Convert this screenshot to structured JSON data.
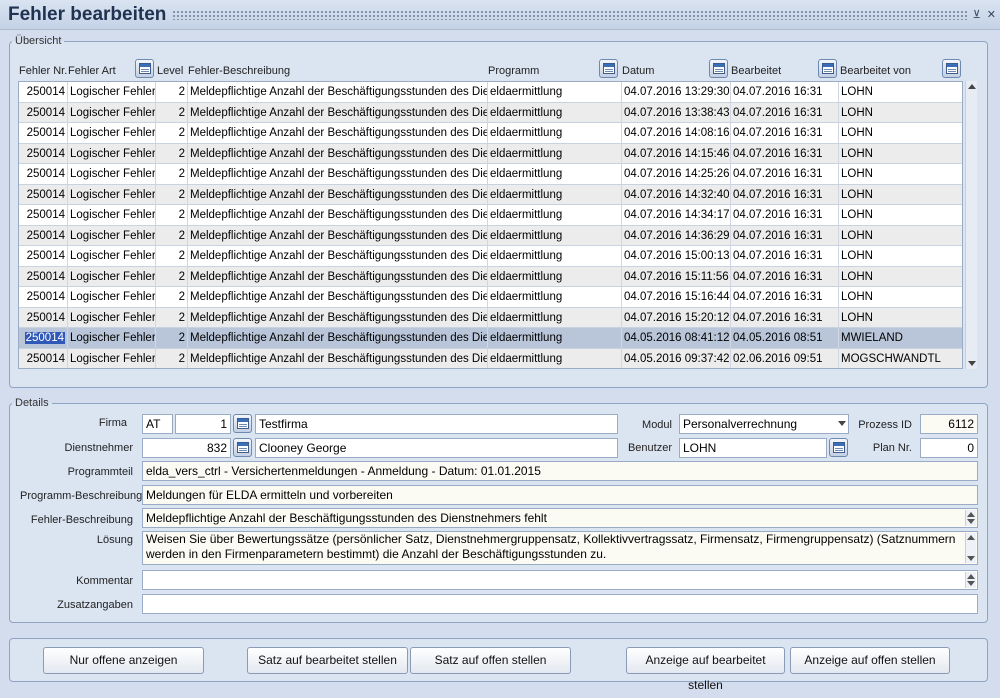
{
  "window": {
    "title": "Fehler bearbeiten",
    "controls": [
      "⊻",
      "✕"
    ]
  },
  "overview": {
    "legend": "Übersicht",
    "columns": {
      "nr": "Fehler Nr.",
      "art": "Fehler Art",
      "level": "Level",
      "desc": "Fehler-Beschreibung",
      "prog": "Programm",
      "datum": "Datum",
      "bearbeitet": "Bearbeitet",
      "von": "Bearbeitet von"
    },
    "rows": [
      {
        "nr": "250014",
        "art": "Logischer Fehler",
        "level": "2",
        "desc": "Meldepflichtige Anzahl der Beschäftigungsstunden des Dien",
        "prog": "eldaermittlung",
        "datum": "04.07.2016 13:29:30",
        "bearbeitet": "04.07.2016 16:31",
        "von": "LOHN"
      },
      {
        "nr": "250014",
        "art": "Logischer Fehler",
        "level": "2",
        "desc": "Meldepflichtige Anzahl der Beschäftigungsstunden des Dien",
        "prog": "eldaermittlung",
        "datum": "04.07.2016 13:38:43",
        "bearbeitet": "04.07.2016 16:31",
        "von": "LOHN"
      },
      {
        "nr": "250014",
        "art": "Logischer Fehler",
        "level": "2",
        "desc": "Meldepflichtige Anzahl der Beschäftigungsstunden des Dien",
        "prog": "eldaermittlung",
        "datum": "04.07.2016 14:08:16",
        "bearbeitet": "04.07.2016 16:31",
        "von": "LOHN"
      },
      {
        "nr": "250014",
        "art": "Logischer Fehler",
        "level": "2",
        "desc": "Meldepflichtige Anzahl der Beschäftigungsstunden des Dien",
        "prog": "eldaermittlung",
        "datum": "04.07.2016 14:15:46",
        "bearbeitet": "04.07.2016 16:31",
        "von": "LOHN"
      },
      {
        "nr": "250014",
        "art": "Logischer Fehler",
        "level": "2",
        "desc": "Meldepflichtige Anzahl der Beschäftigungsstunden des Dien",
        "prog": "eldaermittlung",
        "datum": "04.07.2016 14:25:26",
        "bearbeitet": "04.07.2016 16:31",
        "von": "LOHN"
      },
      {
        "nr": "250014",
        "art": "Logischer Fehler",
        "level": "2",
        "desc": "Meldepflichtige Anzahl der Beschäftigungsstunden des Dien",
        "prog": "eldaermittlung",
        "datum": "04.07.2016 14:32:40",
        "bearbeitet": "04.07.2016 16:31",
        "von": "LOHN"
      },
      {
        "nr": "250014",
        "art": "Logischer Fehler",
        "level": "2",
        "desc": "Meldepflichtige Anzahl der Beschäftigungsstunden des Dien",
        "prog": "eldaermittlung",
        "datum": "04.07.2016 14:34:17",
        "bearbeitet": "04.07.2016 16:31",
        "von": "LOHN"
      },
      {
        "nr": "250014",
        "art": "Logischer Fehler",
        "level": "2",
        "desc": "Meldepflichtige Anzahl der Beschäftigungsstunden des Dien",
        "prog": "eldaermittlung",
        "datum": "04.07.2016 14:36:29",
        "bearbeitet": "04.07.2016 16:31",
        "von": "LOHN"
      },
      {
        "nr": "250014",
        "art": "Logischer Fehler",
        "level": "2",
        "desc": "Meldepflichtige Anzahl der Beschäftigungsstunden des Dien",
        "prog": "eldaermittlung",
        "datum": "04.07.2016 15:00:13",
        "bearbeitet": "04.07.2016 16:31",
        "von": "LOHN"
      },
      {
        "nr": "250014",
        "art": "Logischer Fehler",
        "level": "2",
        "desc": "Meldepflichtige Anzahl der Beschäftigungsstunden des Dien",
        "prog": "eldaermittlung",
        "datum": "04.07.2016 15:11:56",
        "bearbeitet": "04.07.2016 16:31",
        "von": "LOHN"
      },
      {
        "nr": "250014",
        "art": "Logischer Fehler",
        "level": "2",
        "desc": "Meldepflichtige Anzahl der Beschäftigungsstunden des Dien",
        "prog": "eldaermittlung",
        "datum": "04.07.2016 15:16:44",
        "bearbeitet": "04.07.2016 16:31",
        "von": "LOHN"
      },
      {
        "nr": "250014",
        "art": "Logischer Fehler",
        "level": "2",
        "desc": "Meldepflichtige Anzahl der Beschäftigungsstunden des Dien",
        "prog": "eldaermittlung",
        "datum": "04.07.2016 15:20:12",
        "bearbeitet": "04.07.2016 16:31",
        "von": "LOHN"
      },
      {
        "nr": "250014",
        "art": "Logischer Fehler",
        "level": "2",
        "desc": "Meldepflichtige Anzahl der Beschäftigungsstunden des Dien",
        "prog": "eldaermittlung",
        "datum": "04.05.2016 08:41:12",
        "bearbeitet": "04.05.2016 08:51",
        "von": "MWIELAND",
        "selected": true
      },
      {
        "nr": "250014",
        "art": "Logischer Fehler",
        "level": "2",
        "desc": "Meldepflichtige Anzahl der Beschäftigungsstunden des Dien",
        "prog": "eldaermittlung",
        "datum": "04.05.2016 09:37:42",
        "bearbeitet": "02.06.2016 09:51",
        "von": "MOGSCHWANDTL"
      }
    ]
  },
  "details": {
    "legend": "Details",
    "firma_label": "Firma",
    "firma_country": "AT",
    "firma_nr": "1",
    "firma_name": "Testfirma",
    "modul_label": "Modul",
    "modul_value": "Personalverrechnung",
    "prozess_label": "Prozess ID",
    "prozess_value": "6112",
    "dn_label": "Dienstnehmer",
    "dn_nr": "832",
    "dn_name": "Clooney George",
    "benutzer_label": "Benutzer",
    "benutzer_value": "LOHN",
    "plan_label": "Plan Nr.",
    "plan_value": "0",
    "programmteil_label": "Programmteil",
    "programmteil_value": "elda_vers_ctrl - Versichertenmeldungen - Anmeldung - Datum: 01.01.2015",
    "progdesc_label": "Programm-Beschreibung",
    "progdesc_value": "Meldungen für ELDA ermitteln und vorbereiten",
    "fehlerdesc_label": "Fehler-Beschreibung",
    "fehlerdesc_value": "Meldepflichtige Anzahl der Beschäftigungsstunden des Dienstnehmers fehlt",
    "loesung_label": "Lösung",
    "loesung_value": "Weisen Sie über Bewertungssätze (persönlicher Satz, Dienstnehmergruppensatz, Kollektivvertragssatz, Firmensatz, Firmengruppensatz) (Satznummern werden in den Firmenparametern bestimmt) die Anzahl der Beschäftigungsstunden zu.",
    "kommentar_label": "Kommentar",
    "kommentar_value": "",
    "zusatz_label": "Zusatzangaben",
    "zusatz_value": ""
  },
  "buttons": {
    "nur_offene": "Nur offene anzeigen",
    "satz_bearbeitet": "Satz auf bearbeitet stellen",
    "satz_offen": "Satz auf offen stellen",
    "anzeige_bearbeitet": "Anzeige auf bearbeitet stellen",
    "anzeige_offen": "Anzeige auf offen stellen"
  },
  "colors": {
    "background": "#d3dded",
    "row_alt": "#ececec",
    "row_selected": "#b9c6da",
    "highlight": "#2f58b8",
    "title": "#1f3250"
  }
}
